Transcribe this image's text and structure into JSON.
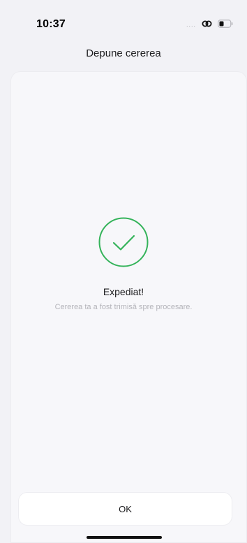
{
  "status_bar": {
    "time": "10:37",
    "signal_dots": "....",
    "icons": [
      "link-icon",
      "battery-icon"
    ]
  },
  "nav": {
    "title": "Depune cererea"
  },
  "success": {
    "icon": "checkmark-circle-icon",
    "title": "Expediat!",
    "subtitle": "Cererea ta a fost trimisă spre procesare."
  },
  "actions": {
    "ok_label": "OK"
  },
  "colors": {
    "accent_success": "#34b35a",
    "background": "#f2f2f6",
    "sheet": "#f7f7fa",
    "muted_text": "#b4b4ba"
  }
}
